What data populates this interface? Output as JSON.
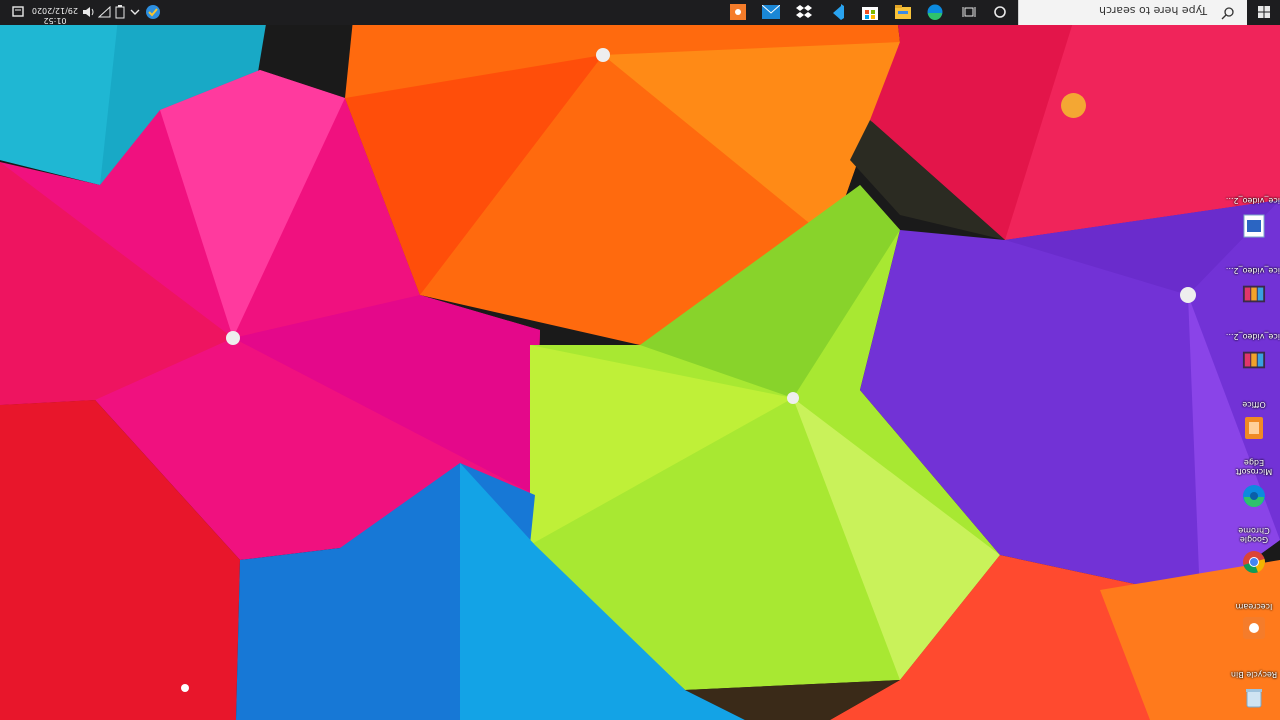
{
  "desktop": {
    "colors": {
      "teal": "#18a9c6",
      "pink": "#f0117f",
      "orange": "#ff6a0e",
      "red": "#e3154a",
      "lime": "#a8e832",
      "purple": "#7232d6",
      "blue": "#1778d6",
      "coral": "#ff4a2f"
    },
    "items": [
      {
        "label": "Recycle Bin",
        "icon": "recycle-bin-icon"
      },
      {
        "label": "Icecream",
        "icon": "icecream-app-icon"
      },
      {
        "label": "Google Chrome",
        "icon": "chrome-icon"
      },
      {
        "label": "Microsoft Edge",
        "icon": "edge-icon"
      },
      {
        "label": "Office",
        "icon": "office-icon"
      },
      {
        "label": "ice_video_2...",
        "icon": "video-file-icon"
      },
      {
        "label": "ice_video_2...",
        "icon": "video-file-icon"
      },
      {
        "label": "ice_video_2...",
        "icon": "word-doc-icon"
      }
    ]
  },
  "taskbar": {
    "search_placeholder": "Type here to search",
    "time": "01:52",
    "date": "29/12/2020",
    "pinned": [
      {
        "name": "start-icon"
      },
      {
        "name": "cortana-icon"
      },
      {
        "name": "task-view-icon"
      },
      {
        "name": "edge-icon"
      },
      {
        "name": "file-explorer-icon"
      },
      {
        "name": "store-icon"
      },
      {
        "name": "visual-studio-code-icon"
      },
      {
        "name": "dropbox-icon"
      },
      {
        "name": "mail-icon"
      },
      {
        "name": "icecream-app-icon"
      }
    ],
    "tray": [
      {
        "name": "chevron-up-icon"
      },
      {
        "name": "battery-icon"
      },
      {
        "name": "network-icon"
      },
      {
        "name": "volume-icon"
      },
      {
        "name": "notifications-icon"
      },
      {
        "name": "windows-security-icon"
      }
    ]
  }
}
